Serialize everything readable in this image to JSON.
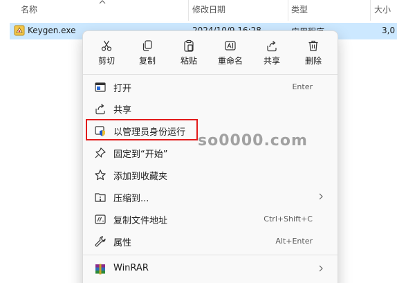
{
  "columns": {
    "name": "名称",
    "modified": "修改日期",
    "type": "类型",
    "size": "大小"
  },
  "file": {
    "name": "Keygen.exe",
    "modified": "2024/10/9 16:28",
    "type": "应用程序",
    "size": "3,0"
  },
  "quick_actions": [
    {
      "label": "剪切",
      "icon": "scissors-icon"
    },
    {
      "label": "复制",
      "icon": "copy-icon"
    },
    {
      "label": "粘贴",
      "icon": "paste-icon"
    },
    {
      "label": "重命名",
      "icon": "rename-icon"
    },
    {
      "label": "共享",
      "icon": "share-icon"
    },
    {
      "label": "删除",
      "icon": "trash-icon"
    }
  ],
  "menu_items": [
    {
      "label": "打开",
      "shortcut": "Enter",
      "icon": "open-window-icon"
    },
    {
      "label": "共享",
      "shortcut": "",
      "icon": "share-icon"
    },
    {
      "label": "以管理员身份运行",
      "shortcut": "",
      "icon": "admin-shield-icon"
    },
    {
      "label": "固定到“开始”",
      "shortcut": "",
      "icon": "pin-icon"
    },
    {
      "label": "添加到收藏夹",
      "shortcut": "",
      "icon": "star-icon"
    },
    {
      "label": "压缩到...",
      "shortcut": "",
      "icon": "zip-folder-icon",
      "submenu": true
    },
    {
      "label": "复制文件地址",
      "shortcut": "Ctrl+Shift+C",
      "icon": "copy-path-icon"
    },
    {
      "label": "属性",
      "shortcut": "Alt+Enter",
      "icon": "wrench-icon"
    },
    {
      "label": "WinRAR",
      "shortcut": "",
      "icon": "winrar-icon",
      "submenu": true
    }
  ],
  "watermark": "so0000.com",
  "colors": {
    "selection": "#cce8ff",
    "highlight_border": "#e21a1a",
    "menu_bg": "#f9f9f9"
  }
}
